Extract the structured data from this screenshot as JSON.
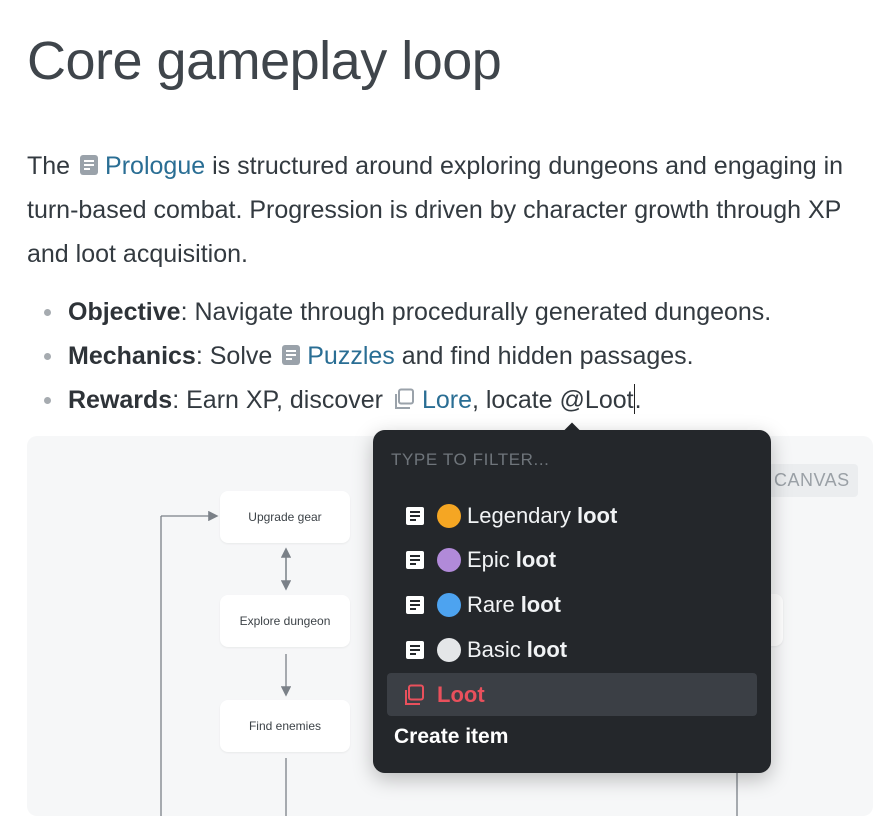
{
  "title": "Core gameplay loop",
  "intro": {
    "part1": "The",
    "link": "Prologue",
    "part2": "is structured around exploring dungeons and engaging in turn-based combat. Progression is driven by character growth through XP and loot acquisition."
  },
  "bullets": [
    {
      "label": "Objective",
      "text": ": Navigate through procedurally generated dungeons."
    },
    {
      "label": "Mechanics",
      "text_a": ": Solve",
      "link": "Puzzles",
      "text_b": "and find hidden passages."
    },
    {
      "label": "Rewards",
      "text_a": ": Earn XP, discover",
      "link": "Lore",
      "text_b": ", locate @Loot",
      "text_c": "."
    }
  ],
  "canvas": {
    "badge": "CANVAS",
    "nodes": [
      "Upgrade gear",
      "Explore dungeon",
      "Find enemies"
    ]
  },
  "popup": {
    "filter_placeholder": "TYPE TO FILTER...",
    "items": [
      {
        "name": "Legendary",
        "suffix": "loot",
        "color": "#f5a623"
      },
      {
        "name": "Epic",
        "suffix": "loot",
        "color": "#b18ad9"
      },
      {
        "name": "Rare",
        "suffix": "loot",
        "color": "#4da3f0"
      },
      {
        "name": "Basic",
        "suffix": "loot",
        "color": "#e4e6e8"
      }
    ],
    "selected": "Loot",
    "create": "Create item"
  }
}
